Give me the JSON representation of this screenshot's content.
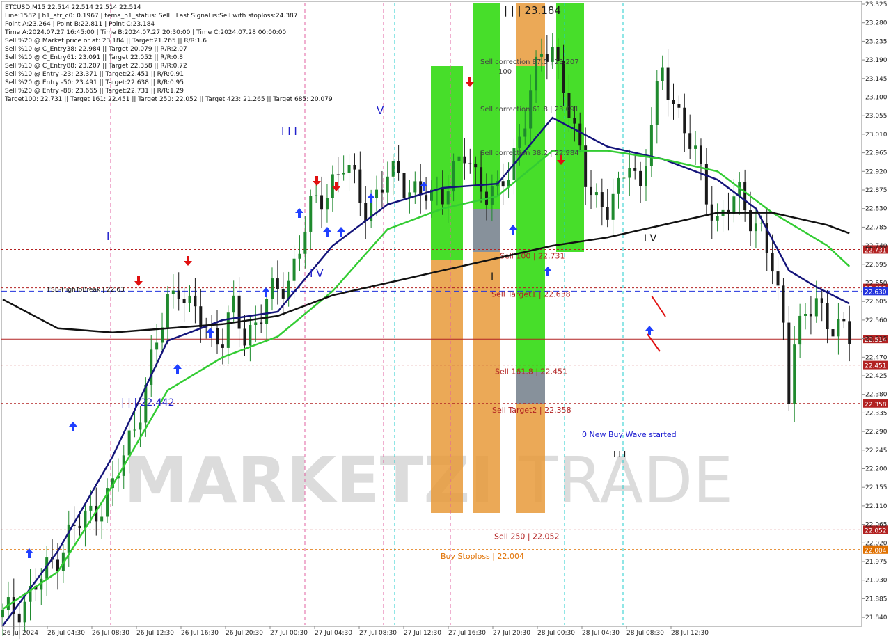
{
  "header": {
    "lines": [
      "ETCUSD,M15  22.514 22.514 22.514 22.514",
      "Line:1582 | h1_atr_c0: 0.1967 | tema_h1_status: Sell | Last Signal is:Sell with stoploss:24.387",
      "Point A:23.264 | Point B:22.811 | Point C:23.184",
      "Time A:2024.07.27 16:45:00 | Time B:2024.07.27 20:30:00 | Time C:2024.07.28 00:00:00",
      "Sell %20 @ Market price or at: 23.184 || Target:21.265 || R/R:1.6",
      "Sell %10 @ C_Entry38: 22.984 || Target:20.079 || R/R:2.07",
      "Sell %10 @ C_Entry61: 23.091 || Target:22.052 || R/R:0.8",
      "Sell %10 @ C_Entry88: 23.207 || Target:22.358 || R/R:0.72",
      "Sell %10 @ Entry -23: 23.371 || Target:22.451 || R/R:0.91",
      "Sell %20 @ Entry -50: 23.491 || Target:22.638 || R/R:0.95",
      "Sell %20 @ Entry -88: 23.665 || Target:22.731 || R/R:1.29",
      "Target100: 22.731 || Target 161: 22.451 || Target 250: 22.052 || Target 423: 21.265 || Target 685: 20.079"
    ]
  },
  "watermark": {
    "left": "MARKETZI",
    "right": "TRADE"
  },
  "colors": {
    "bull": "#1f8a2e",
    "bear": "#1a1a1a",
    "ma_blue": "#14147a",
    "ma_green": "#33cc33",
    "ma_black": "#111111",
    "red_level": "#b22222",
    "blue_level": "#2233dd",
    "green_zone": "#3ddc1f",
    "orange_zone": "#e89a3a",
    "grey_zone": "#7a8590"
  },
  "chart_data": {
    "type": "candlestick",
    "symbol": "ETCUSD",
    "timeframe": "M15",
    "ylim": [
      21.825,
      23.325
    ],
    "y_ticks": [
      "23.325",
      "23.280",
      "23.235",
      "23.190",
      "23.145",
      "23.100",
      "23.055",
      "23.010",
      "22.965",
      "22.920",
      "22.875",
      "22.830",
      "22.785",
      "22.740",
      "22.695",
      "22.650",
      "22.605",
      "22.560",
      "22.515",
      "22.470",
      "22.425",
      "22.380",
      "22.335",
      "22.290",
      "22.245",
      "22.200",
      "22.155",
      "22.110",
      "22.065",
      "22.020",
      "21.975",
      "21.930",
      "21.885",
      "21.840"
    ],
    "x_labels": [
      "26 Jul 2024",
      "26 Jul 04:30",
      "26 Jul 08:30",
      "26 Jul 12:30",
      "26 Jul 16:30",
      "26 Jul 20:30",
      "27 Jul 00:30",
      "27 Jul 04:30",
      "27 Jul 08:30",
      "27 Jul 12:30",
      "27 Jul 16:30",
      "27 Jul 20:30",
      "28 Jul 00:30",
      "28 Jul 04:30",
      "28 Jul 08:30",
      "28 Jul 12:30"
    ],
    "price_series": [
      [
        0,
        21.84
      ],
      [
        4,
        21.88
      ],
      [
        8,
        21.95
      ],
      [
        12,
        22.04
      ],
      [
        16,
        22.09
      ],
      [
        20,
        22.15
      ],
      [
        24,
        22.31
      ],
      [
        26,
        22.4
      ],
      [
        28,
        22.5
      ],
      [
        30,
        22.61
      ],
      [
        32,
        22.65
      ],
      [
        34,
        22.58
      ],
      [
        36,
        22.56
      ],
      [
        38,
        22.53
      ],
      [
        40,
        22.52
      ],
      [
        42,
        22.58
      ],
      [
        44,
        22.52
      ],
      [
        46,
        22.56
      ],
      [
        48,
        22.6
      ],
      [
        50,
        22.63
      ],
      [
        52,
        22.66
      ],
      [
        54,
        22.74
      ],
      [
        56,
        22.82
      ],
      [
        58,
        22.86
      ],
      [
        60,
        22.9
      ],
      [
        62,
        22.93
      ],
      [
        64,
        22.89
      ],
      [
        66,
        22.84
      ],
      [
        68,
        22.86
      ],
      [
        70,
        22.9
      ],
      [
        72,
        22.92
      ],
      [
        74,
        22.88
      ],
      [
        76,
        22.86
      ],
      [
        78,
        22.85
      ],
      [
        80,
        22.88
      ],
      [
        82,
        22.92
      ],
      [
        84,
        22.95
      ],
      [
        86,
        22.91
      ],
      [
        88,
        22.88
      ],
      [
        90,
        22.86
      ],
      [
        92,
        22.91
      ],
      [
        94,
        23.01
      ],
      [
        96,
        23.12
      ],
      [
        98,
        23.19
      ],
      [
        100,
        23.22
      ],
      [
        102,
        23.14
      ],
      [
        104,
        23.0
      ],
      [
        106,
        22.9
      ],
      [
        108,
        22.86
      ],
      [
        110,
        22.83
      ],
      [
        112,
        22.86
      ],
      [
        114,
        22.96
      ],
      [
        116,
        22.88
      ],
      [
        118,
        23.03
      ],
      [
        120,
        23.16
      ],
      [
        122,
        23.1
      ],
      [
        124,
        23.02
      ],
      [
        126,
        22.95
      ],
      [
        128,
        22.87
      ],
      [
        130,
        22.8
      ],
      [
        132,
        22.83
      ],
      [
        134,
        22.86
      ],
      [
        136,
        22.82
      ],
      [
        138,
        22.77
      ],
      [
        140,
        22.68
      ],
      [
        142,
        22.55
      ],
      [
        143,
        22.4
      ],
      [
        144,
        22.52
      ],
      [
        146,
        22.56
      ],
      [
        148,
        22.6
      ],
      [
        150,
        22.57
      ],
      [
        152,
        22.54
      ],
      [
        154,
        22.51
      ]
    ],
    "moving_averages": [
      {
        "name": "blue",
        "values": [
          [
            0,
            21.82
          ],
          [
            10,
            22.0
          ],
          [
            20,
            22.23
          ],
          [
            30,
            22.51
          ],
          [
            40,
            22.56
          ],
          [
            50,
            22.58
          ],
          [
            60,
            22.74
          ],
          [
            70,
            22.84
          ],
          [
            80,
            22.88
          ],
          [
            90,
            22.89
          ],
          [
            100,
            23.05
          ],
          [
            110,
            22.98
          ],
          [
            120,
            22.95
          ],
          [
            130,
            22.9
          ],
          [
            137,
            22.83
          ],
          [
            143,
            22.68
          ],
          [
            148,
            22.64
          ],
          [
            154,
            22.6
          ]
        ]
      },
      {
        "name": "green",
        "values": [
          [
            0,
            21.86
          ],
          [
            10,
            21.95
          ],
          [
            20,
            22.16
          ],
          [
            30,
            22.39
          ],
          [
            40,
            22.47
          ],
          [
            50,
            22.52
          ],
          [
            60,
            22.63
          ],
          [
            70,
            22.78
          ],
          [
            80,
            22.83
          ],
          [
            90,
            22.86
          ],
          [
            100,
            22.97
          ],
          [
            110,
            22.97
          ],
          [
            120,
            22.95
          ],
          [
            130,
            22.92
          ],
          [
            140,
            22.82
          ],
          [
            150,
            22.74
          ],
          [
            154,
            22.69
          ]
        ]
      },
      {
        "name": "black",
        "values": [
          [
            0,
            22.61
          ],
          [
            10,
            22.54
          ],
          [
            20,
            22.53
          ],
          [
            30,
            22.54
          ],
          [
            40,
            22.55
          ],
          [
            50,
            22.57
          ],
          [
            60,
            22.62
          ],
          [
            70,
            22.65
          ],
          [
            80,
            22.68
          ],
          [
            90,
            22.71
          ],
          [
            100,
            22.74
          ],
          [
            110,
            22.76
          ],
          [
            120,
            22.79
          ],
          [
            130,
            22.82
          ],
          [
            140,
            22.82
          ],
          [
            150,
            22.79
          ],
          [
            154,
            22.77
          ]
        ]
      }
    ],
    "levels": [
      {
        "price": 22.731,
        "label": "Sell 100 | 22.731",
        "tag": "22.731",
        "color": "#b22222"
      },
      {
        "price": 22.638,
        "label": "Sell Target1 | 22.638",
        "tag": "22.638",
        "color": "#b22222"
      },
      {
        "price": 22.63,
        "label": "",
        "tag": "22.630",
        "color": "#2233dd"
      },
      {
        "price": 22.514,
        "label": "",
        "tag": "22.514",
        "color": "#b22222"
      },
      {
        "price": 22.451,
        "label": "Sell 161.8 | 22.451",
        "tag": "22.451",
        "color": "#b22222"
      },
      {
        "price": 22.358,
        "label": "Sell Target2 | 22.358",
        "tag": "22.358",
        "color": "#b22222"
      },
      {
        "price": 22.052,
        "label": "Sell  250 | 22.052",
        "tag": "22.052",
        "color": "#b22222"
      },
      {
        "price": 22.004,
        "label": "Buy Stoploss | 22.004",
        "tag": "22.004",
        "color": "#e07000"
      }
    ],
    "annotations": {
      "fsb": "FSB-HighToBreak | 22.63",
      "sell_corrections": [
        "Sell correction 87.5 | 23.207",
        "Sell correction 61.8 | 23.091",
        "Sell correction 38.2 | 22.984"
      ],
      "wave_c": "| | | 23.184",
      "wave_low": "| | | 22.442",
      "new_buy_wave": "0 New Buy Wave started",
      "wave_marks": [
        "I",
        "I I I",
        "V",
        "I V",
        "I V",
        "I",
        "I I I",
        "100"
      ]
    },
    "grid": false
  }
}
